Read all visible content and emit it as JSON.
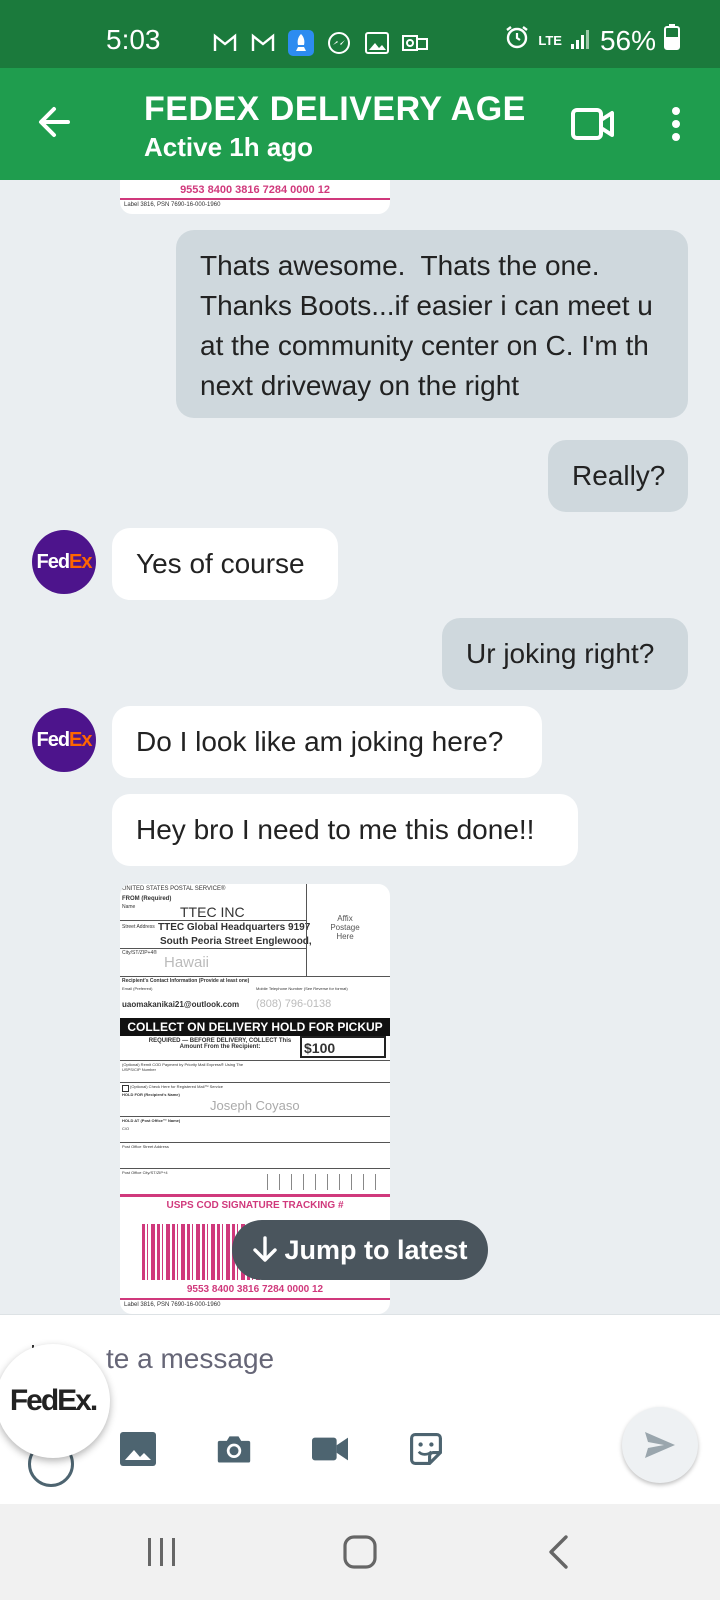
{
  "status_bar": {
    "time": "5:03",
    "network": "LTE",
    "battery": "56%"
  },
  "header": {
    "title": "FEDEX DELIVERY AGE...",
    "subtitle": "Active 1h ago"
  },
  "messages": [
    {
      "direction": "out",
      "text": "Thats awesome.  Thats the one.\nThanks Boots...if easier i can meet u at the community center on C. I'm th next driveway on the right"
    },
    {
      "direction": "out",
      "text": "Really?"
    },
    {
      "direction": "in",
      "text": "Yes of course"
    },
    {
      "direction": "out",
      "text": "Ur joking right?"
    },
    {
      "direction": "in",
      "text": "Do I look like am joking here?"
    },
    {
      "direction": "in",
      "text": "Hey bro I need to me this done!!"
    }
  ],
  "avatar": {
    "fed": "Fed",
    "ex": "Ex"
  },
  "label_image_top": {
    "tracking": "9553 8400 3816 7284 0000 12",
    "footer": "Label 3816,          PSN 7690-16-000-1960"
  },
  "label_image": {
    "agency": "UNITED STATES POSTAL SERVICE®",
    "from_label": "FROM (Required)",
    "name_label": "Name",
    "from_name": "TTEC INC",
    "street_label": "Street Address",
    "street_line1": "TTEC Global Headquarters 9197",
    "street_line2": "South Peoria Street Englewood,",
    "city_label": "City/ST/ZIP+4®",
    "city": "Hawaii",
    "postage": "Affix\nPostage\nHere",
    "recipient_contact": "Recipient's Contact Information (Provide at least one)",
    "email_label": "Email (Preferred)",
    "phone_label": "Mobile Telephone Number (See Reverse for format)",
    "email": "uaomakanikai21@outlook.com",
    "phone": "(808) 796-0138",
    "cod_banner": "COLLECT ON DELIVERY HOLD FOR PICKUP",
    "required_text": "REQUIRED — BEFORE DELIVERY, COLLECT This Amount From the Recipient:",
    "amount": "$100",
    "remit_note": "(Optional) Remit COD Payment by Priority Mail Express® Using The USPS/CIP Number",
    "registered_note": "(Optional) Check Here for Registered Mail™ Service",
    "hold_for_label": "HOLD FOR (Recipient's Name)",
    "hold_for_name": "Joseph Coyaso",
    "hold_at_label": "HOLD AT (Post Office™ Name)",
    "co_label": "C/O",
    "po_street_label": "Post Office Street Address",
    "po_city_label": "Post Office City/ST/ZIP+4",
    "signature_tracking": "USPS COD SIGNATURE TRACKING #",
    "tracking": "9553 8400 3816 7284 0000 12",
    "footer": "Label 3816,          PSN 7690-16-000-1960"
  },
  "jump_to_latest": "Jump to latest",
  "composer": {
    "placeholder": "Write a message",
    "visible_text": "te a message"
  },
  "floating_avatar": {
    "text": "FedEx."
  }
}
